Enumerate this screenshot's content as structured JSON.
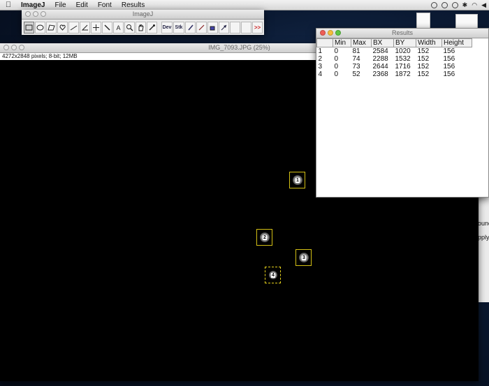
{
  "menubar": {
    "app_name": "ImageJ",
    "items": [
      "File",
      "Edit",
      "Font",
      "Results"
    ]
  },
  "toolbar_window": {
    "title": "ImageJ",
    "tools": [
      {
        "icon": "rectangle-tool-icon",
        "selected": true
      },
      {
        "icon": "oval-tool-icon"
      },
      {
        "icon": "polygon-tool-icon"
      },
      {
        "icon": "freehand-tool-icon"
      },
      {
        "icon": "line-tool-icon"
      },
      {
        "icon": "angle-tool-icon"
      },
      {
        "icon": "point-tool-icon"
      },
      {
        "icon": "wand-tool-icon"
      },
      {
        "icon": "text-tool-icon",
        "glyph": "A"
      },
      {
        "icon": "magnifier-tool-icon"
      },
      {
        "icon": "hand-tool-icon"
      },
      {
        "icon": "dropper-tool-icon"
      }
    ],
    "extra_tools": [
      {
        "icon": "developer-menu-icon",
        "label": "Dev"
      },
      {
        "icon": "stack-menu-icon",
        "label": "Stk"
      },
      {
        "icon": "brush-tool-icon"
      },
      {
        "icon": "pencil-tool-icon"
      },
      {
        "icon": "flood-fill-tool-icon"
      },
      {
        "icon": "arrow-tool-icon"
      }
    ],
    "more_label": ">>"
  },
  "image_window": {
    "title": "IMG_7093.JPG (25%)",
    "info": "4272x2848 pixels; 8-bit; 12MB",
    "rois": [
      {
        "label": "1"
      },
      {
        "label": "2"
      },
      {
        "label": "3"
      },
      {
        "label": "4",
        "active": true
      }
    ]
  },
  "results_window": {
    "title": "Results",
    "columns": [
      "",
      "Min",
      "Max",
      "BX",
      "BY",
      "Width",
      "Height"
    ],
    "rows": [
      [
        "1",
        "0",
        "81",
        "2584",
        "1020",
        "152",
        "156"
      ],
      [
        "2",
        "0",
        "74",
        "2288",
        "1532",
        "152",
        "156"
      ],
      [
        "3",
        "0",
        "73",
        "2644",
        "1716",
        "152",
        "156"
      ],
      [
        "4",
        "0",
        "52",
        "2368",
        "1872",
        "152",
        "156"
      ]
    ]
  },
  "side_panel": {
    "lines": [
      "ound",
      "pply"
    ]
  },
  "colors": {
    "roi": "#d4c015",
    "desktop": "#0b1a33"
  }
}
